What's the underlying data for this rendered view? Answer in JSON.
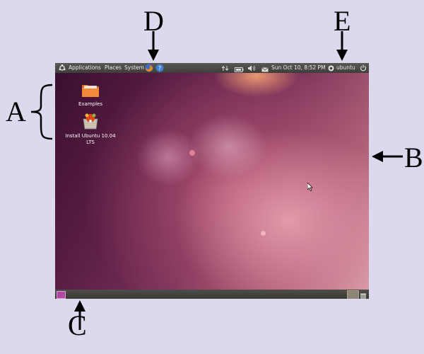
{
  "callouts": {
    "a": "A",
    "b": "B",
    "c": "C",
    "d": "D",
    "e": "E"
  },
  "top_panel": {
    "menu_applications": "Applications",
    "menu_places": "Places",
    "menu_system": "System",
    "datetime": "Sun Oct 10,  8:52 PM",
    "user": "ubuntu"
  },
  "desktop": {
    "icons": [
      {
        "label": "Examples",
        "icon": "folder-icon"
      },
      {
        "label": "Install Ubuntu 10.04 LTS",
        "icon": "installer-icon"
      }
    ]
  },
  "colors": {
    "page_background": "#dcd8ee",
    "panel": "#3e3d3a",
    "wallpaper_accent": "#7a3258"
  }
}
